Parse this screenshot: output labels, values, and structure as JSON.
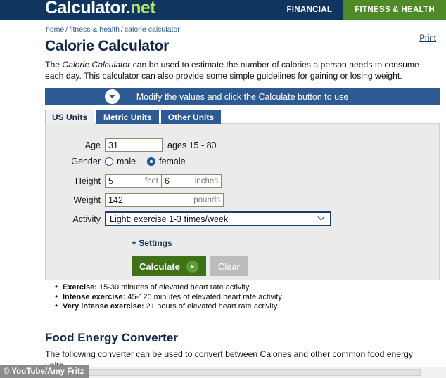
{
  "topbar": {
    "logo_main": "Calculator",
    "logo_dot": ".",
    "logo_tld": "net",
    "nav": [
      {
        "label": "FINANCIAL",
        "color": "#10355f"
      },
      {
        "label": "FITNESS & HEALTH",
        "color": "#4e8b27"
      }
    ]
  },
  "breadcrumb": {
    "items": [
      "home",
      "fitness & health",
      "calorie calculator"
    ],
    "separator": "/"
  },
  "print_label": "Print",
  "page_title": "Calorie Calculator",
  "intro": {
    "before": "The ",
    "italic": "Calorie Calculator",
    "after": " can be used to estimate the number of calories a person needs to consume each day. This calculator can also provide some simple guidelines for gaining or losing weight."
  },
  "modify_bar": {
    "text": "Modify the values and click the Calculate button to use",
    "icon": "chevron-down-circle-icon",
    "background": "#2d5a92"
  },
  "tabs": [
    {
      "label": "US Units",
      "active": true
    },
    {
      "label": "Metric Units",
      "active": false
    },
    {
      "label": "Other Units",
      "active": false
    }
  ],
  "form": {
    "age": {
      "label": "Age",
      "value": "31",
      "hint": "ages 15 - 80"
    },
    "gender": {
      "label": "Gender",
      "options": [
        {
          "label": "male",
          "selected": false
        },
        {
          "label": "female",
          "selected": true
        }
      ]
    },
    "height": {
      "label": "Height",
      "feet_value": "5",
      "feet_unit": "feet",
      "inches_value": "6",
      "inches_unit": "inches"
    },
    "weight": {
      "label": "Weight",
      "value": "142",
      "unit": "pounds"
    },
    "activity": {
      "label": "Activity",
      "selected": "Light: exercise 1-3 times/week",
      "caret_icon": "chevron-down-icon"
    },
    "settings_link": "+ Settings",
    "calculate_label": "Calculate",
    "calculate_icon": "play-icon",
    "clear_label": "Clear",
    "accent_green": "#3f7218",
    "accent_blue": "#2d5a92"
  },
  "bullets": [
    {
      "bold": "Exercise:",
      "text": " 15-30 minutes of elevated heart rate activity."
    },
    {
      "bold": "Intense exercise:",
      "text": " 45-120 minutes of elevated heart rate activity."
    },
    {
      "bold": "Very intense exercise:",
      "text": " 2+ hours of elevated heart rate activity."
    }
  ],
  "section2": {
    "title": "Food Energy Converter",
    "text": "The following converter can be used to convert between Calories and other common food energy units."
  },
  "watermark": "© YouTube/Amy Fritz"
}
